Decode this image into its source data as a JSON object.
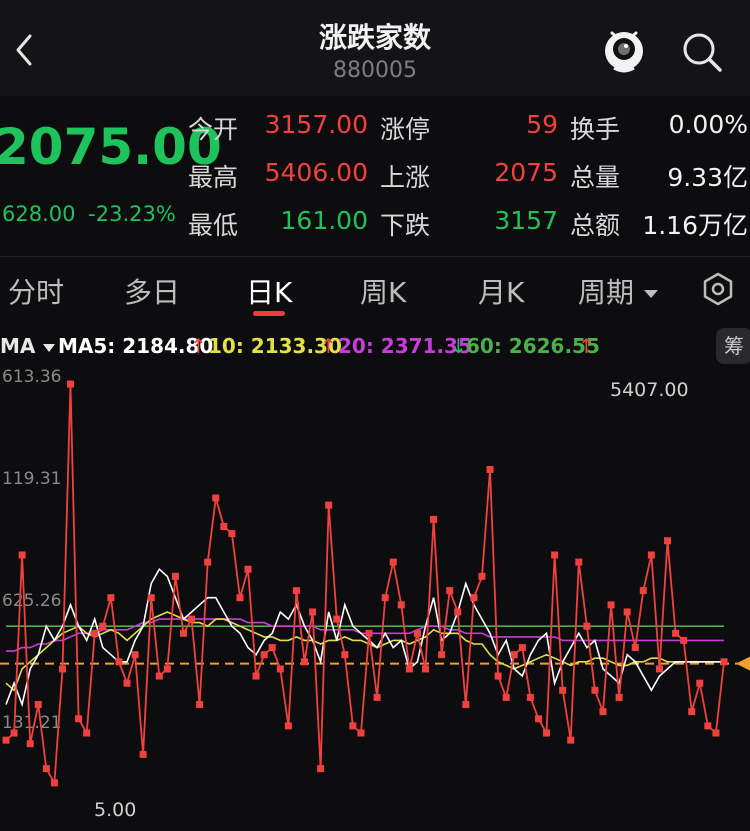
{
  "header": {
    "title": "涨跌家数",
    "code": "880005",
    "back_icon": "chevron-left-icon",
    "mascot_icon": "mascot-icon",
    "search_icon": "search-icon"
  },
  "quote": {
    "price": "2075.00",
    "change": "628.00",
    "change_pct": "-23.23%",
    "rows": [
      {
        "l1": "今开",
        "v1": "3157.00",
        "c1": "red",
        "l2": "涨停",
        "v2": "59",
        "c2": "red",
        "l3": "换手",
        "v3": "0.00%",
        "c3": "white"
      },
      {
        "l1": "最高",
        "v1": "5406.00",
        "c1": "red",
        "l2": "上涨",
        "v2": "2075",
        "c2": "red",
        "l3": "总量",
        "v3": "9.33亿",
        "c3": "white"
      },
      {
        "l1": "最低",
        "v1": "161.00",
        "c1": "green",
        "l2": "下跌",
        "v2": "3157",
        "c2": "green",
        "l3": "总额",
        "v3": "1.16万亿",
        "c3": "white"
      }
    ]
  },
  "tabs": {
    "items": [
      "分时",
      "多日",
      "日K",
      "周K",
      "月K",
      "周期"
    ],
    "active": "日K",
    "settings_icon": "hexagon-settings-icon"
  },
  "ma": {
    "selector": "MA",
    "ma5": "MA5: 2184.80",
    "ma10": "10: 2133.30",
    "ma20": "20: 2371.35",
    "ma60": "60: 2626.55",
    "arrow_up": "↑",
    "arrow_down": "↓",
    "chip_label": "筹"
  },
  "colors": {
    "up": "#f0413f",
    "down": "#1fc35b",
    "ma5": "#ffffff",
    "ma10": "#e1e04a",
    "ma20": "#c83cdc",
    "ma60": "#4bb04b",
    "dashed": "#f0a030"
  },
  "chart_data": {
    "type": "line",
    "y_ticks": [
      "613.36",
      "119.31",
      "625.26",
      "131.21"
    ],
    "y_top": 6113.36,
    "y_bottom": 5.0,
    "max_label": "5407.00",
    "min_label": "5.00",
    "current": 2075.0,
    "series": [
      {
        "name": "涨跌家数",
        "values": [
          1000,
          1100,
          3600,
          950,
          1500,
          600,
          400,
          2000,
          6000,
          1300,
          1100,
          2500,
          2600,
          3000,
          2100,
          1800,
          2200,
          800,
          3000,
          1900,
          2000,
          3300,
          2500,
          2700,
          1500,
          3500,
          4400,
          4000,
          3900,
          3000,
          3400,
          1900,
          2200,
          2300,
          2000,
          1200,
          3100,
          2100,
          2800,
          600,
          4300,
          2700,
          2200,
          1200,
          1100,
          2500,
          1600,
          3000,
          3500,
          2900,
          2000,
          2500,
          2000,
          4100,
          2200,
          3100,
          2800,
          1500,
          3000,
          3300,
          4800,
          1900,
          1600,
          2200,
          2300,
          1600,
          1300,
          1100,
          3600,
          1700,
          1000,
          3500,
          2600,
          1700,
          1400,
          2900,
          1600,
          2800,
          2300,
          3100,
          3600,
          2000,
          3800,
          2500,
          2400,
          1400,
          1800,
          1200,
          1100,
          2100
        ]
      },
      {
        "name": "MA5",
        "values": [
          1500,
          1800,
          1500,
          2000,
          2200,
          2600,
          2400,
          2600,
          2900,
          2600,
          2400,
          2700,
          2300,
          2200,
          2100,
          2100,
          2400,
          2600,
          3200,
          3400,
          3300,
          3000,
          2700,
          2800,
          2900,
          3000,
          3000,
          2800,
          2600,
          2500,
          2300,
          2200,
          2400,
          2500,
          2800,
          2700,
          2900,
          2600,
          2400,
          2100,
          2800,
          2400,
          2900,
          2600,
          2500,
          2400,
          2300,
          2500,
          2300,
          2400,
          2000,
          2100,
          2600,
          3000,
          2400,
          2500,
          2800,
          3200,
          2900,
          2700,
          2500,
          2200,
          2400,
          2000,
          1900,
          2200,
          2400,
          2500,
          1800,
          2100,
          2300,
          2500,
          2300,
          2400,
          2000,
          1900,
          1800,
          2200,
          2100,
          1900,
          1700,
          1900,
          2000,
          2100,
          2100,
          2100,
          2100,
          2100,
          2100,
          2100
        ]
      },
      {
        "name": "MA10",
        "values": [
          1800,
          1700,
          2000,
          2100,
          2200,
          2300,
          2400,
          2500,
          2550,
          2600,
          2500,
          2450,
          2500,
          2550,
          2500,
          2400,
          2500,
          2600,
          2700,
          2750,
          2800,
          2750,
          2700,
          2650,
          2650,
          2600,
          2700,
          2700,
          2650,
          2600,
          2550,
          2500,
          2450,
          2450,
          2400,
          2400,
          2450,
          2400,
          2400,
          2350,
          2400,
          2400,
          2450,
          2400,
          2400,
          2350,
          2300,
          2350,
          2400,
          2400,
          2350,
          2400,
          2450,
          2550,
          2500,
          2500,
          2500,
          2400,
          2350,
          2350,
          2200,
          2100,
          2050,
          2000,
          2050,
          2100,
          2150,
          2200,
          2150,
          2100,
          2050,
          2100,
          2100,
          2150,
          2150,
          2100,
          2050,
          2050,
          2100,
          2100,
          2150,
          2150,
          2100,
          2100,
          2100,
          2100,
          2100,
          2100,
          2100,
          2100
        ]
      },
      {
        "name": "MA20",
        "values": [
          2250,
          2250,
          2300,
          2300,
          2350,
          2350,
          2400,
          2400,
          2450,
          2500,
          2500,
          2500,
          2550,
          2550,
          2550,
          2550,
          2600,
          2650,
          2650,
          2700,
          2700,
          2700,
          2700,
          2700,
          2700,
          2700,
          2700,
          2700,
          2700,
          2700,
          2650,
          2650,
          2650,
          2600,
          2600,
          2600,
          2600,
          2600,
          2600,
          2550,
          2550,
          2550,
          2550,
          2550,
          2500,
          2500,
          2500,
          2500,
          2500,
          2500,
          2500,
          2550,
          2600,
          2600,
          2600,
          2550,
          2550,
          2500,
          2500,
          2500,
          2450,
          2450,
          2450,
          2450,
          2450,
          2450,
          2450,
          2450,
          2450,
          2400,
          2400,
          2400,
          2400,
          2400,
          2400,
          2400,
          2400,
          2400,
          2400,
          2400,
          2400,
          2400,
          2400,
          2400,
          2400,
          2400,
          2400,
          2400,
          2400,
          2400
        ]
      },
      {
        "name": "MA60",
        "values": [
          2600,
          2600,
          2600,
          2600,
          2600,
          2600,
          2600,
          2600,
          2600,
          2600,
          2600,
          2600,
          2600,
          2600,
          2600,
          2600,
          2600,
          2600,
          2600,
          2600,
          2600,
          2600,
          2600,
          2600,
          2600,
          2600,
          2600,
          2600,
          2600,
          2600,
          2600,
          2600,
          2600,
          2600,
          2600,
          2600,
          2600,
          2600,
          2600,
          2600,
          2600,
          2600,
          2600,
          2600,
          2600,
          2600,
          2600,
          2600,
          2600,
          2600,
          2600,
          2600,
          2600,
          2600,
          2600,
          2600,
          2600,
          2600,
          2600,
          2600,
          2600,
          2600,
          2600,
          2600,
          2600,
          2600,
          2600,
          2600,
          2600,
          2600,
          2600,
          2600,
          2600,
          2600,
          2600,
          2600,
          2600,
          2600,
          2600,
          2600,
          2600,
          2600,
          2600,
          2600,
          2600,
          2600,
          2600,
          2600,
          2600,
          2600
        ]
      }
    ]
  }
}
